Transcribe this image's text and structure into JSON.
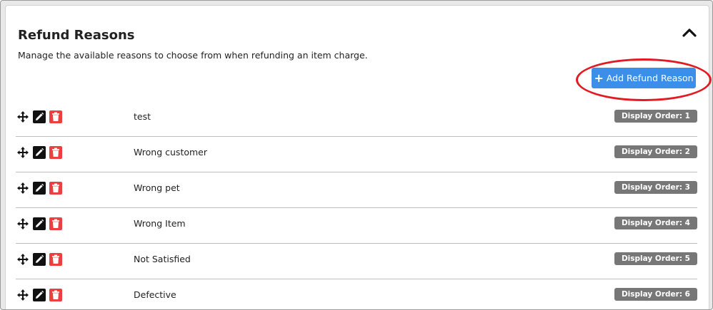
{
  "section": {
    "title": "Refund Reasons",
    "description": "Manage the available reasons to choose from when refunding an item charge.",
    "add_button_label": "Add Refund Reason"
  },
  "icons": {
    "collapse": "chevron-up-icon",
    "drag": "move-arrows-icon",
    "edit": "pencil-icon",
    "delete": "trash-icon",
    "add": "plus-icon"
  },
  "colors": {
    "primary": "#3b8fe9",
    "danger": "#ec4040",
    "badge": "#777777",
    "highlight_ring": "#e21a23"
  },
  "reasons": [
    {
      "label": "test",
      "order": "Display Order: 1"
    },
    {
      "label": "Wrong customer",
      "order": "Display Order: 2"
    },
    {
      "label": "Wrong pet",
      "order": "Display Order: 3"
    },
    {
      "label": "Wrong Item",
      "order": "Display Order: 4"
    },
    {
      "label": "Not Satisfied",
      "order": "Display Order: 5"
    },
    {
      "label": "Defective",
      "order": "Display Order: 6"
    }
  ]
}
